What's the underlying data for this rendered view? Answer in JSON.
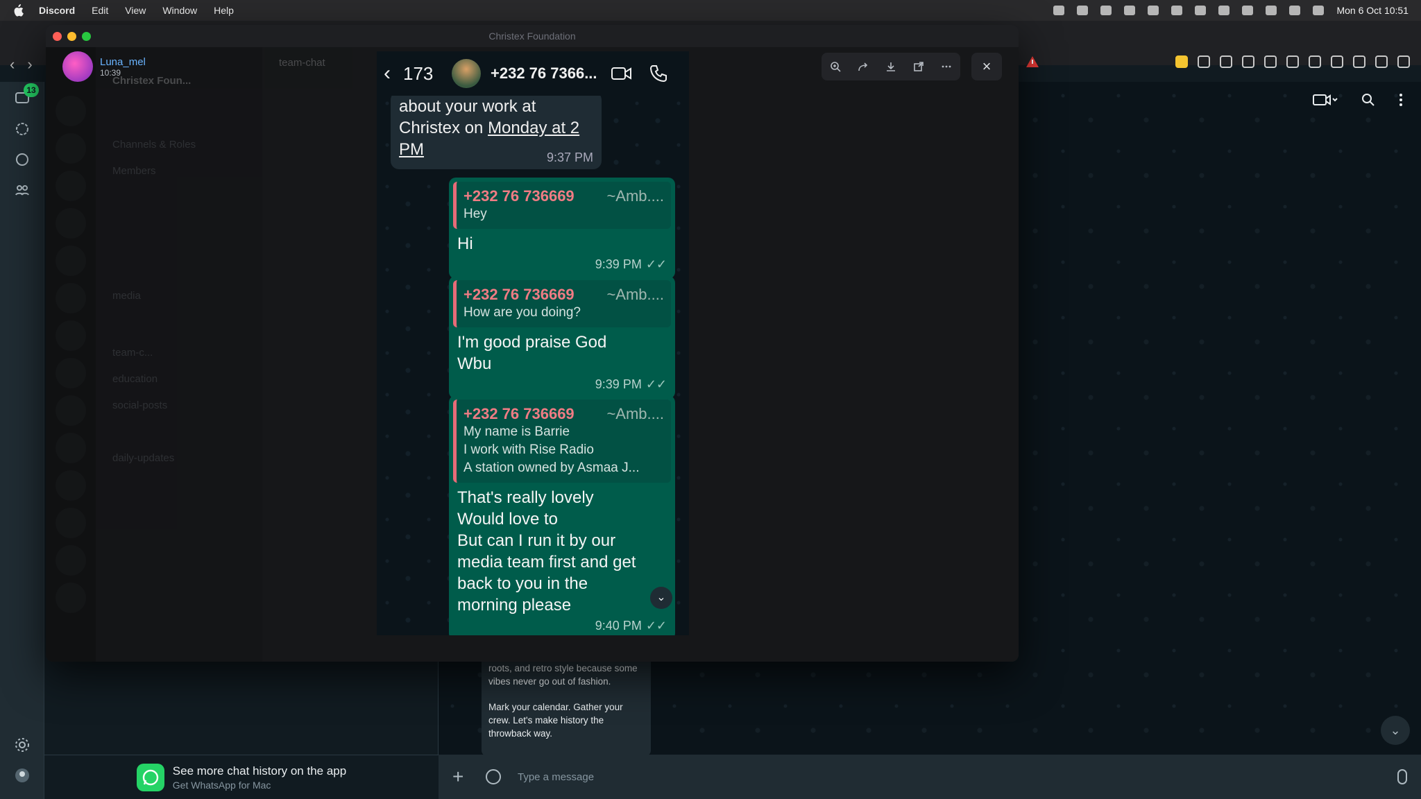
{
  "menubar": {
    "app_name": "Discord",
    "items": [
      "Edit",
      "View",
      "Window",
      "Help"
    ],
    "clock": "Mon 6 Oct  10:51"
  },
  "whatsapp_web": {
    "rail_badge": "13",
    "promo_title": "See more chat history on the app",
    "promo_subtitle": "Get WhatsApp for Mac",
    "bubble_text": [
      "roots, and retro style because some vibes never go out of fashion.",
      "Mark your calendar. Gather your crew. Let's make history the throwback way."
    ],
    "input_placeholder": "Type a message"
  },
  "discord": {
    "window_title": "Christex Foundation",
    "user_name": "Luna_mel",
    "user_time": "10:39",
    "server_name": "Christex Foun...",
    "channel_name": "team-chat",
    "channel_items": [
      "Channels & Roles",
      "Members",
      "media",
      "team-c...",
      "education",
      "social-posts",
      "daily-updates"
    ]
  },
  "viewer": {
    "tools": [
      "zoom-in",
      "forward",
      "download",
      "open-external",
      "more"
    ],
    "close_label": "×"
  },
  "screenshot": {
    "back_count": "173",
    "contact_name": "+232 76 7366...",
    "incoming": {
      "line1": "about your work at",
      "line2": "Christex on ",
      "line2_link": "Monday at 2",
      "line3_link": "PM",
      "time": "9:37 PM"
    },
    "messages": [
      {
        "quote_number": "+232 76 736669",
        "quote_alias": "~Amb....",
        "quote_text": [
          "Hey"
        ],
        "reply": [
          "Hi"
        ],
        "time": "9:39 PM"
      },
      {
        "quote_number": "+232 76 736669",
        "quote_alias": "~Amb....",
        "quote_text": [
          "How are you doing?"
        ],
        "reply": [
          "I'm good praise God",
          "Wbu"
        ],
        "time": "9:39 PM"
      },
      {
        "quote_number": "+232 76 736669",
        "quote_alias": "~Amb....",
        "quote_text": [
          "My name is Barrie",
          "I work with Rise Radio",
          "A station owned by Asmaa J..."
        ],
        "reply": [
          "That's really lovely",
          "Would love to",
          "But can I run it by our",
          "media team first and get",
          "back to you in the",
          "morning please"
        ],
        "time": "9:40 PM"
      }
    ]
  }
}
